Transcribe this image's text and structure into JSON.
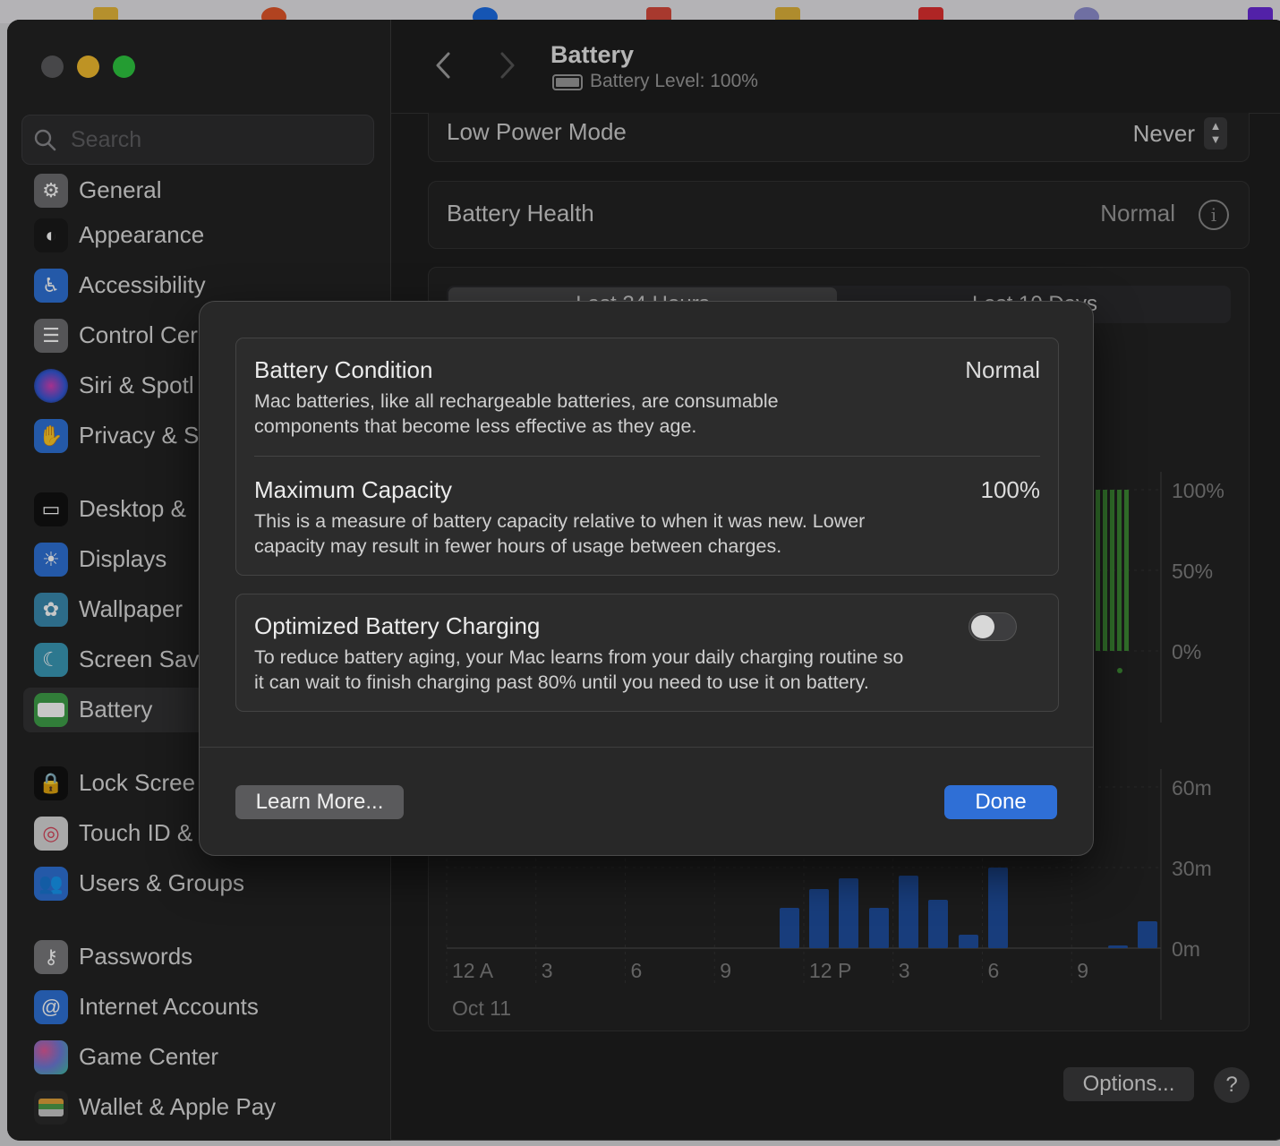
{
  "window_title": "Battery",
  "battery_level_text": "Battery Level: 100%",
  "search": {
    "placeholder": "Search"
  },
  "sidebar": {
    "items": [
      {
        "label": "General"
      },
      {
        "label": "Appearance"
      },
      {
        "label": "Accessibility"
      },
      {
        "label": "Control Cer"
      },
      {
        "label": "Siri & Spotl"
      },
      {
        "label": "Privacy & S"
      },
      {
        "label": "Desktop &"
      },
      {
        "label": "Displays"
      },
      {
        "label": "Wallpaper"
      },
      {
        "label": "Screen Sav"
      },
      {
        "label": "Battery"
      },
      {
        "label": "Lock Scree"
      },
      {
        "label": "Touch ID &"
      },
      {
        "label": "Users & Groups"
      },
      {
        "label": "Passwords"
      },
      {
        "label": "Internet Accounts"
      },
      {
        "label": "Game Center"
      },
      {
        "label": "Wallet & Apple Pay"
      }
    ]
  },
  "main": {
    "low_power_mode": {
      "label": "Low Power Mode",
      "value": "Never"
    },
    "battery_health": {
      "label": "Battery Health",
      "value": "Normal"
    },
    "tabs": [
      "Last 24 Hours",
      "Last 10 Days"
    ],
    "options_label": "Options...",
    "help_label": "?"
  },
  "chart_data": [
    {
      "type": "bar",
      "title": "",
      "y_ticks": [
        "100%",
        "50%",
        "0%"
      ],
      "ylim": [
        0,
        100
      ],
      "series": [
        {
          "values": [
            100,
            100,
            100,
            100,
            100
          ]
        }
      ],
      "color": "#3f8f36"
    },
    {
      "type": "bar",
      "title": "",
      "x_ticks": [
        "12 A",
        "3",
        "6",
        "9",
        "12 P",
        "3",
        "6",
        "9"
      ],
      "x_date": "Oct 11",
      "y_ticks": [
        "60m",
        "30m",
        "0m"
      ],
      "ylim": [
        0,
        60
      ],
      "values_minutes": [
        15,
        22,
        26,
        15,
        27,
        18,
        5,
        30,
        1,
        10
      ],
      "color": "#1f4f9f"
    }
  ],
  "modal": {
    "battery_condition": {
      "title": "Battery Condition",
      "value": "Normal",
      "desc_line1": "Mac batteries, like all rechargeable batteries, are consumable",
      "desc_line2": "components that become less effective as they age."
    },
    "maximum_capacity": {
      "title": "Maximum Capacity",
      "value": "100%",
      "desc_line1": "This is a measure of battery capacity relative to when it was new. Lower",
      "desc_line2": "capacity may result in fewer hours of usage between charges."
    },
    "optimized_charging": {
      "title": "Optimized Battery Charging",
      "enabled": false,
      "desc_line1": "To reduce battery aging, your Mac learns from your daily charging routine so",
      "desc_line2": "it can wait to finish charging past 80% until you need to use it on battery."
    },
    "learn_more_label": "Learn More...",
    "done_label": "Done"
  },
  "colors": {
    "accent": "#2f6fd6",
    "window_bg": "#1e1e1e",
    "sidebar_bg": "#232323"
  }
}
